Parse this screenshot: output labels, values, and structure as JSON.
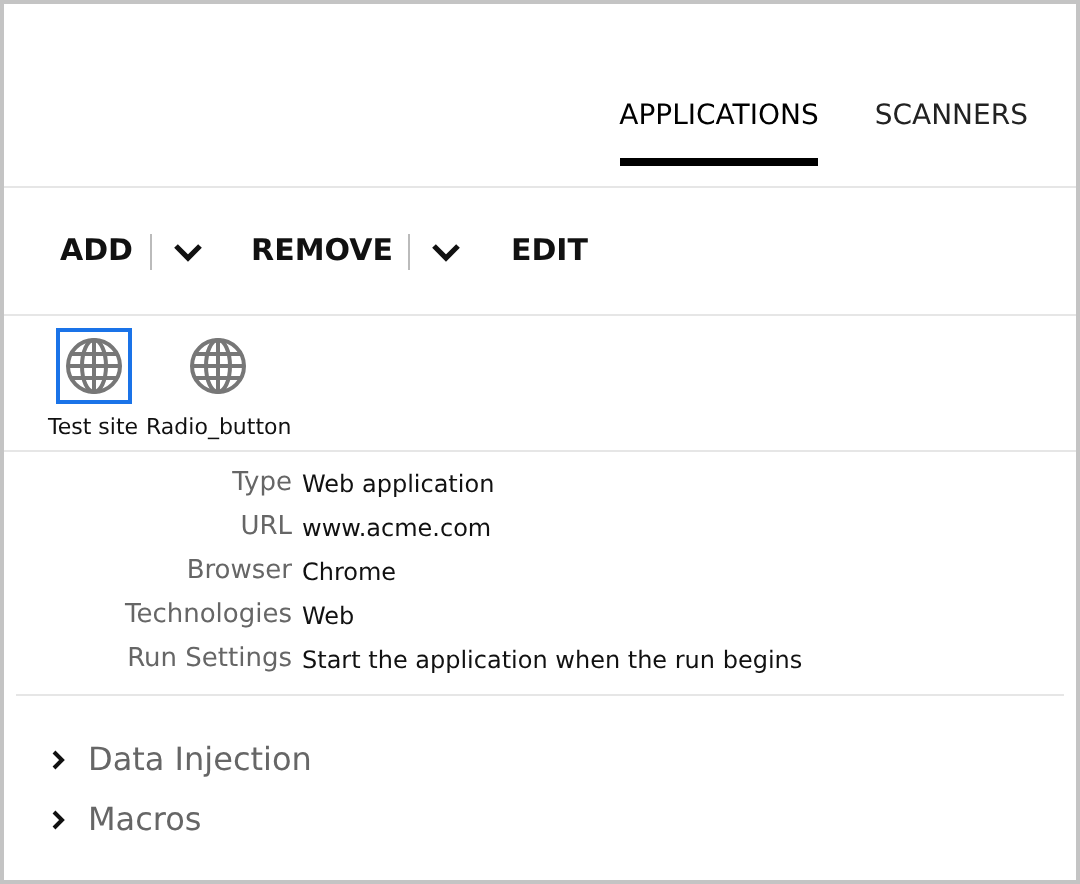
{
  "tabs": [
    {
      "label": "APPLICATIONS",
      "selected": true
    },
    {
      "label": "SCANNERS",
      "selected": false
    }
  ],
  "toolbar": [
    {
      "label": "ADD",
      "has_menu": true
    },
    {
      "label": "REMOVE",
      "has_menu": true
    },
    {
      "label": "EDIT",
      "has_menu": false
    }
  ],
  "items": [
    {
      "label": "Test site",
      "selected": true
    },
    {
      "label": "Radio_button",
      "selected": false
    }
  ],
  "properties": [
    {
      "label": "Type",
      "value": "Web application"
    },
    {
      "label": "URL",
      "value": "www.acme.com"
    },
    {
      "label": "Browser",
      "value": "Chrome"
    },
    {
      "label": "Technologies",
      "value": "Web"
    },
    {
      "label": "Run Settings",
      "value": "Start the application when the run begins"
    }
  ],
  "sections": [
    {
      "label": "Data Injection",
      "expanded": false
    },
    {
      "label": "Macros",
      "expanded": false
    }
  ]
}
